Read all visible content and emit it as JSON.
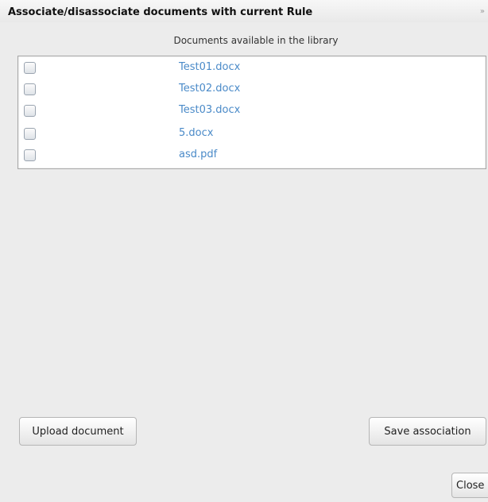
{
  "dialog": {
    "title": "Associate/disassociate documents with current Rule",
    "close_glyph": "»"
  },
  "library": {
    "caption": "Documents available in the library",
    "documents": [
      {
        "name": "Test01.docx",
        "checked": false
      },
      {
        "name": "Test02.docx",
        "checked": false
      },
      {
        "name": "Test03.docx",
        "checked": false
      },
      {
        "name": "5.docx",
        "checked": false
      },
      {
        "name": "asd.pdf",
        "checked": false
      }
    ]
  },
  "buttons": {
    "upload_label": "Upload document",
    "save_label": "Save association",
    "close_label": "Close"
  },
  "colors": {
    "link": "#4a8ac8",
    "dialog_bg": "#ececec"
  }
}
